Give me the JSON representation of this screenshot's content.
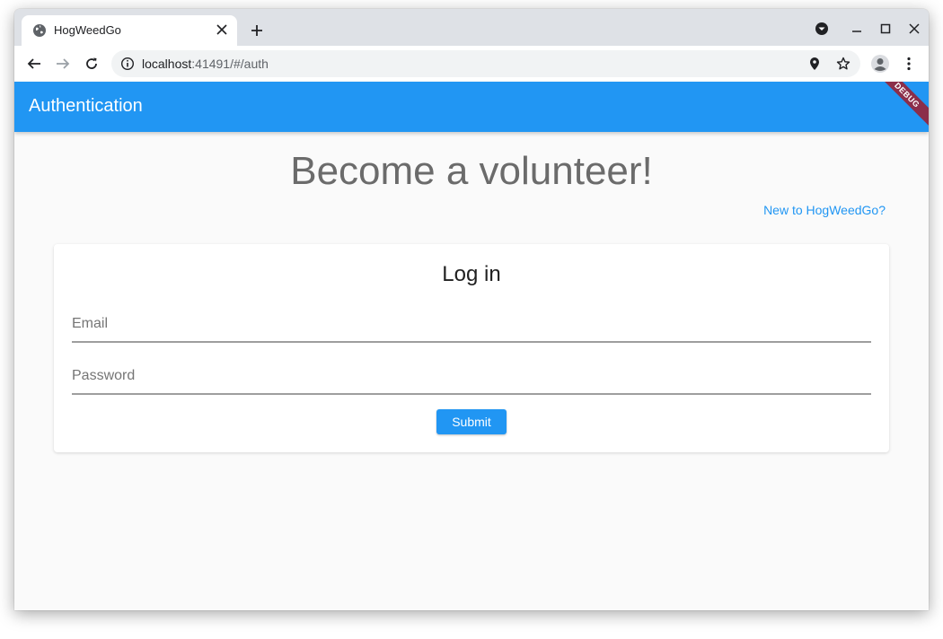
{
  "browser": {
    "tab_title": "HogWeedGo",
    "url_host": "localhost",
    "url_rest": ":41491/#/auth"
  },
  "icons": {
    "favicon": "globe-icon",
    "tab_close": "close-icon",
    "new_tab": "plus-icon",
    "back": "arrow-left-icon",
    "forward": "arrow-right-icon",
    "reload": "reload-icon",
    "site_info": "info-icon",
    "location": "location-pin-icon",
    "bookmark": "star-icon",
    "profile": "profile-icon",
    "menu": "kebab-menu-icon"
  },
  "appbar": {
    "title": "Authentication",
    "debug_label": "DEBUG"
  },
  "page": {
    "headline": "Become a volunteer!",
    "new_link": "New to HogWeedGo?"
  },
  "login": {
    "title": "Log in",
    "email_placeholder": "Email",
    "password_placeholder": "Password",
    "submit_label": "Submit"
  },
  "colors": {
    "primary": "#2196f3",
    "debug_banner": "#8b2e4a",
    "background": "#fafafa"
  }
}
